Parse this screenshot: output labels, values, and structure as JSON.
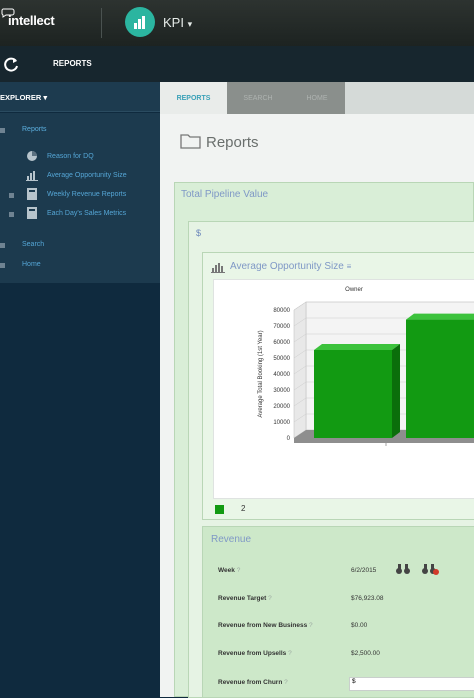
{
  "topbar": {
    "logo": "intellect",
    "app": "KPI",
    "app_caret": "▾"
  },
  "bar2": {
    "section": "REPORTS"
  },
  "sidebar": {
    "header": "EXPLORER ▾",
    "items": [
      {
        "label": "Reports"
      },
      {
        "label": "Reason for DQ"
      },
      {
        "label": "Average Opportunity Size"
      },
      {
        "label": "Weekly Revenue Reports"
      },
      {
        "label": "Each Day's Sales Metrics"
      },
      {
        "label": "Search"
      },
      {
        "label": "Home"
      }
    ]
  },
  "tabs": [
    "REPORTS",
    "SEARCH",
    "HOME"
  ],
  "panel": {
    "title": "Reports"
  },
  "pipeline": {
    "title": "Total Pipeline Value",
    "sub": "$"
  },
  "aos": {
    "title": "Average Opportunity Size",
    "suffix": "≡"
  },
  "chart_data": {
    "type": "bar",
    "title": "Owner",
    "ylabel": "Average Total Booking (1st Year)",
    "ylim": [
      0,
      80000
    ],
    "yticks": [
      "80000",
      "70000",
      "60000",
      "50000",
      "40000",
      "30000",
      "20000",
      "10000",
      "0"
    ],
    "series": [
      {
        "name": "",
        "values": [
          55000,
          74000
        ]
      }
    ],
    "legend": [
      "2"
    ],
    "color": "#129a12"
  },
  "revenue": {
    "title": "Revenue",
    "rows": [
      {
        "label": "Week",
        "value": "6/2/2015"
      },
      {
        "label": "Revenue Target",
        "value": "$76,923.08"
      },
      {
        "label": "Revenue from New Business",
        "value": "$0.00"
      },
      {
        "label": "Revenue from Upsells",
        "value": "$2,500.00"
      },
      {
        "label": "Revenue from Churn",
        "value": "$"
      }
    ],
    "help_glyph": "?"
  }
}
